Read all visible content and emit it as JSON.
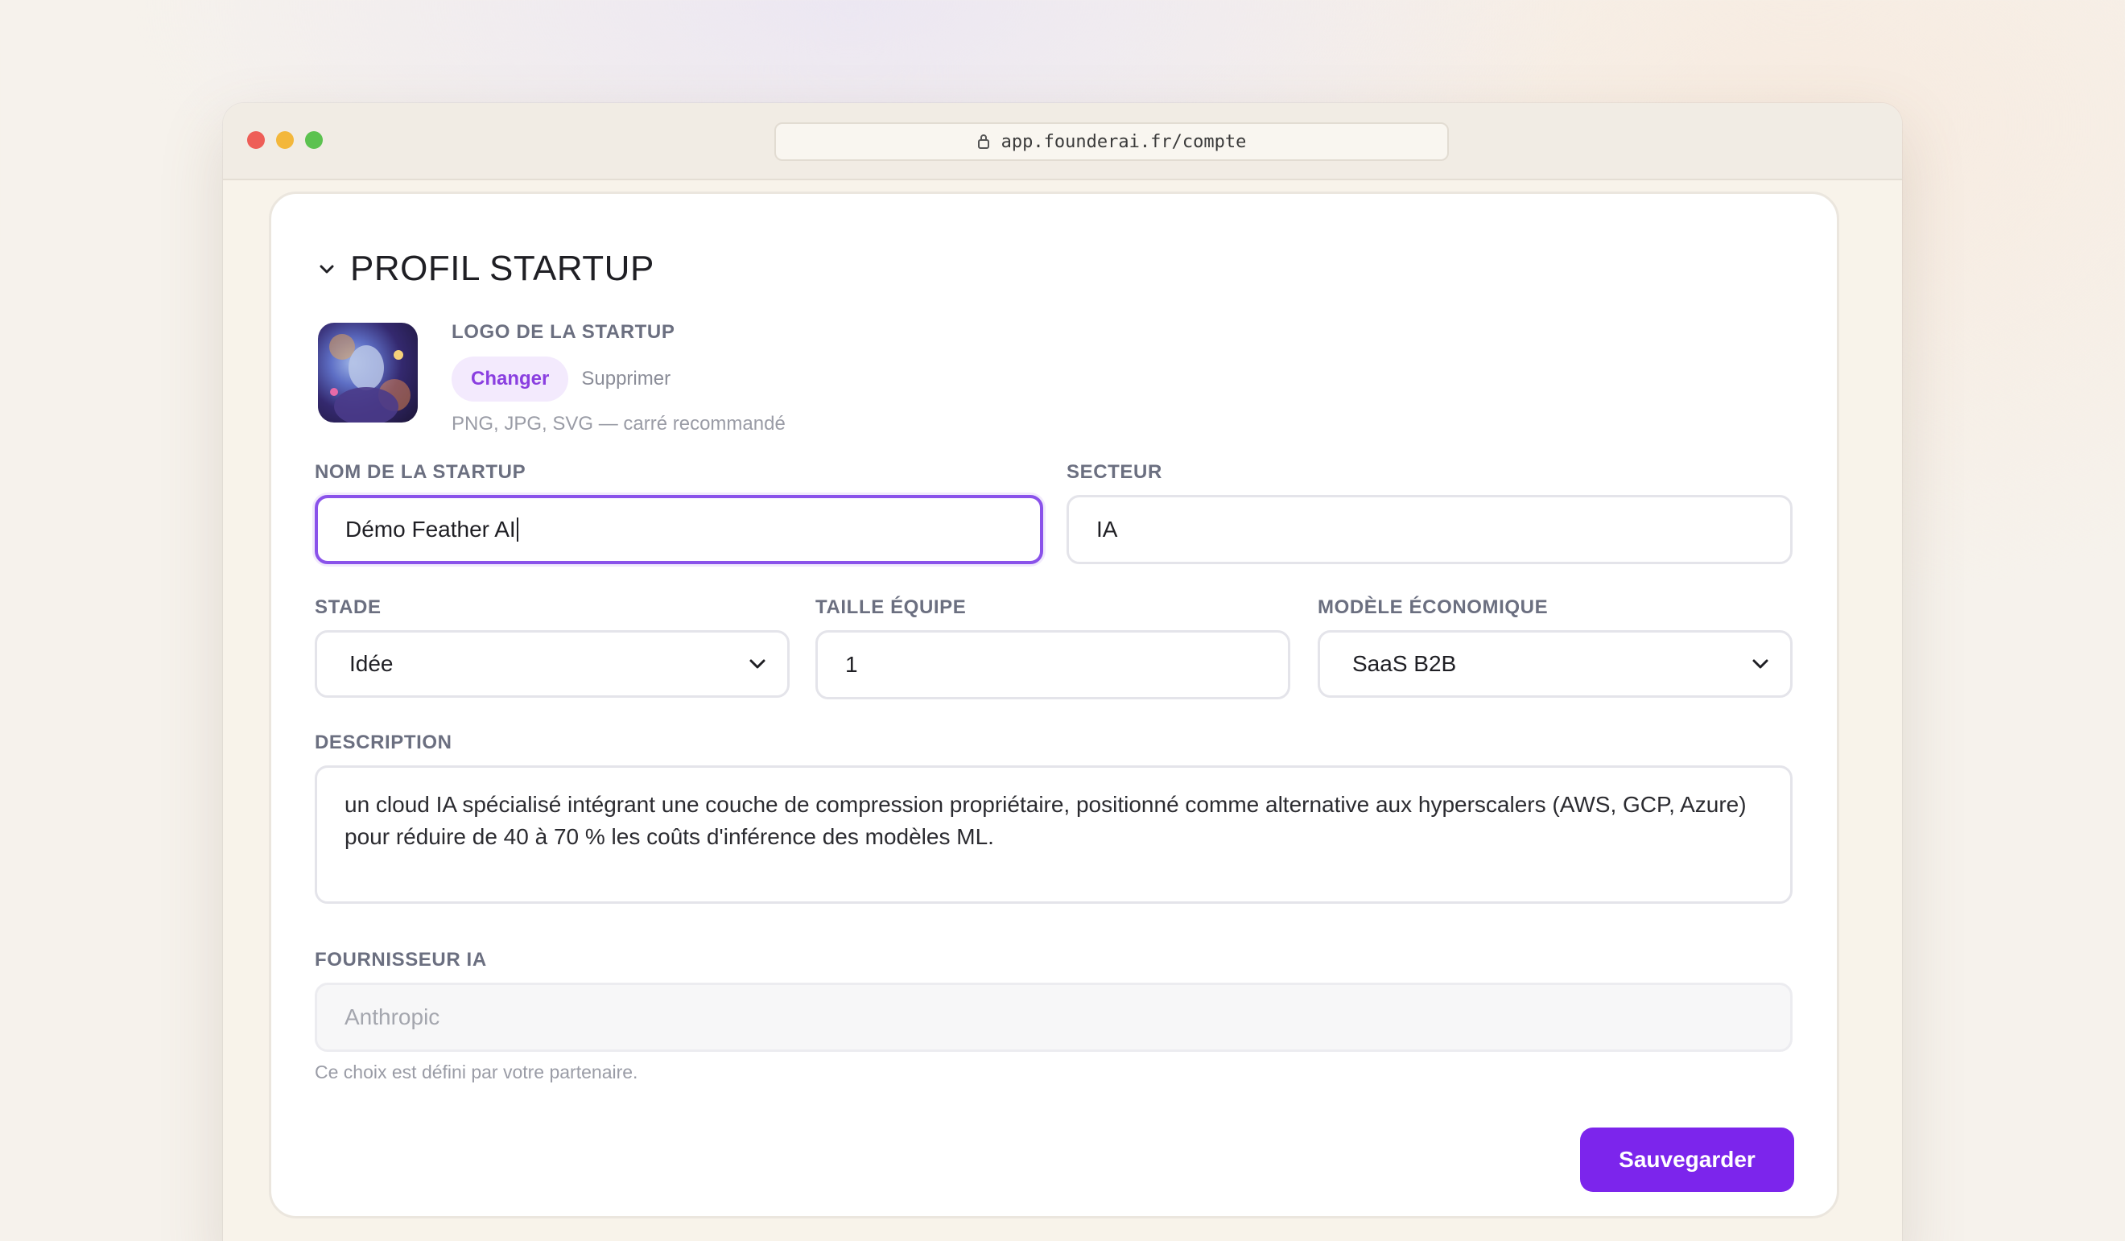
{
  "browser": {
    "url": "app.founderai.fr/compte"
  },
  "section": {
    "title": "PROFIL STARTUP"
  },
  "logo": {
    "label": "LOGO DE LA STARTUP",
    "change_label": "Changer",
    "remove_label": "Supprimer",
    "hint": "PNG, JPG, SVG — carré recommandé"
  },
  "fields": {
    "name": {
      "label": "NOM DE LA STARTUP",
      "value": "Démo Feather AI"
    },
    "sector": {
      "label": "SECTEUR",
      "value": "IA"
    },
    "stage": {
      "label": "STADE",
      "value": "Idée"
    },
    "team_size": {
      "label": "TAILLE ÉQUIPE",
      "value": "1"
    },
    "business_model": {
      "label": "MODÈLE ÉCONOMIQUE",
      "value": "SaaS B2B"
    },
    "description": {
      "label": "DESCRIPTION",
      "value": "un cloud IA spécialisé intégrant une couche de compression propriétaire, positionné comme alternative aux hyperscalers (AWS, GCP, Azure) pour réduire de 40 à 70 % les coûts d'inférence des modèles ML."
    },
    "ai_provider": {
      "label": "FOURNISSEUR IA",
      "value": "Anthropic",
      "help": "Ce choix est défini par votre partenaire."
    }
  },
  "actions": {
    "save_label": "Sauvegarder"
  },
  "colors": {
    "accent": "#7c25ec",
    "focus_border": "#8a52ea"
  }
}
